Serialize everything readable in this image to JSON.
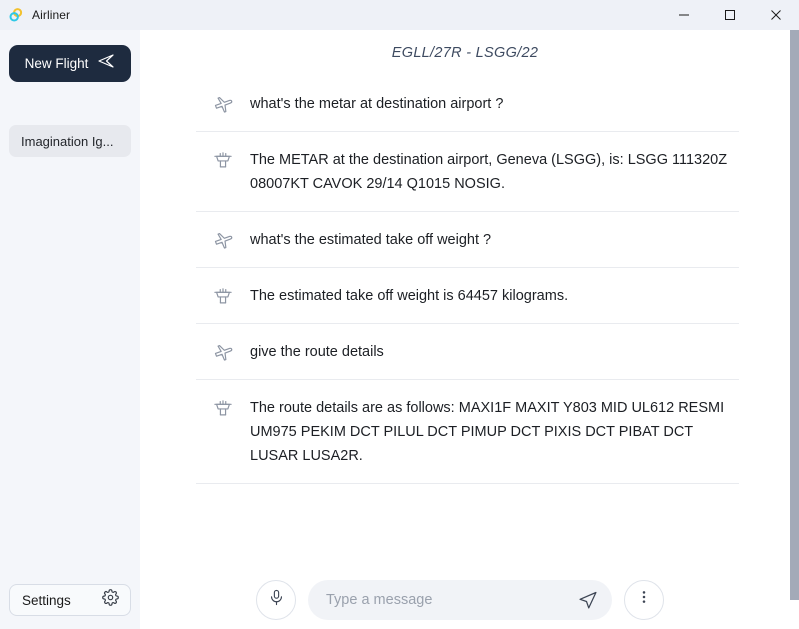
{
  "window": {
    "app_title": "Airliner",
    "app_icon": "airliner-logo-icon",
    "controls": {
      "minimize": "minimize-icon",
      "maximize": "maximize-icon",
      "close": "close-icon"
    },
    "colors": {
      "titlebar_bg": "#eef1f7",
      "sidebar_bg": "#f4f6fa",
      "accent_dark": "#1e2b3f",
      "input_bg": "#f1f3f7",
      "scrollbar": "#a3aab8"
    }
  },
  "sidebar": {
    "new_flight": {
      "label": "New Flight",
      "icon": "paper-plane-icon"
    },
    "chats": [
      {
        "label": "Imagination Ig..."
      }
    ],
    "settings": {
      "label": "Settings",
      "icon": "gear-icon"
    }
  },
  "main": {
    "header_title": "EGLL/27R - LSGG/22",
    "messages": [
      {
        "role": "user",
        "icon": "airplane-icon",
        "text": "what's the metar at destination airport ?"
      },
      {
        "role": "assistant",
        "icon": "control-tower-icon",
        "text": "The METAR at the destination airport, Geneva (LSGG), is: LSGG 111320Z 08007KT CAVOK 29/14 Q1015 NOSIG."
      },
      {
        "role": "user",
        "icon": "airplane-icon",
        "text": "what's the estimated take off weight ?"
      },
      {
        "role": "assistant",
        "icon": "control-tower-icon",
        "text": "The estimated take off weight is 64457 kilograms."
      },
      {
        "role": "user",
        "icon": "airplane-icon",
        "text": "give the route details"
      },
      {
        "role": "assistant",
        "icon": "control-tower-icon",
        "text": "The route details are as follows: MAXI1F MAXIT Y803 MID UL612 RESMI UM975 PEKIM DCT PILUL DCT PIMUP DCT PIXIS DCT PIBAT DCT LUSAR LUSA2R."
      }
    ],
    "composer": {
      "mic_icon": "microphone-icon",
      "placeholder": "Type a message",
      "value": "",
      "send_icon": "send-paper-plane-icon",
      "more_icon": "more-vertical-icon"
    }
  }
}
